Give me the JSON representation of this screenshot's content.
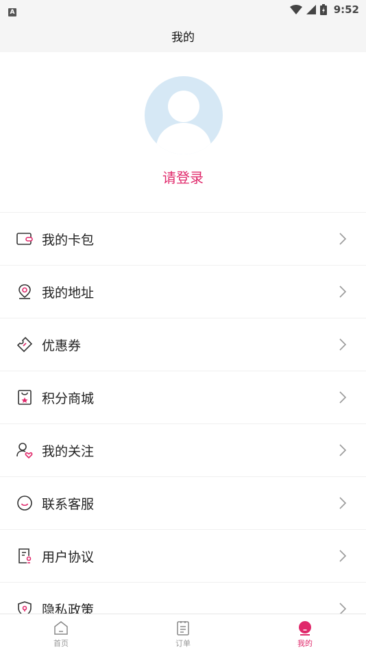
{
  "status_bar": {
    "time": "9:52",
    "notif_badge": "A"
  },
  "header": {
    "title": "我的"
  },
  "profile": {
    "login_text": "请登录"
  },
  "menu": [
    {
      "label": "我的卡包",
      "icon": "wallet-icon"
    },
    {
      "label": "我的地址",
      "icon": "location-icon"
    },
    {
      "label": "优惠券",
      "icon": "coupon-icon"
    },
    {
      "label": "积分商城",
      "icon": "points-mall-icon"
    },
    {
      "label": "我的关注",
      "icon": "follow-icon"
    },
    {
      "label": "联系客服",
      "icon": "customer-service-icon"
    },
    {
      "label": "用户协议",
      "icon": "agreement-icon"
    },
    {
      "label": "隐私政策",
      "icon": "privacy-icon"
    }
  ],
  "tabs": [
    {
      "label": "首页",
      "icon": "home-icon",
      "active": false
    },
    {
      "label": "订单",
      "icon": "orders-icon",
      "active": false
    },
    {
      "label": "我的",
      "icon": "profile-icon",
      "active": true
    }
  ],
  "colors": {
    "accent": "#e0296b",
    "icon_gray": "#444444",
    "avatar_bg": "#d6e8f5"
  }
}
